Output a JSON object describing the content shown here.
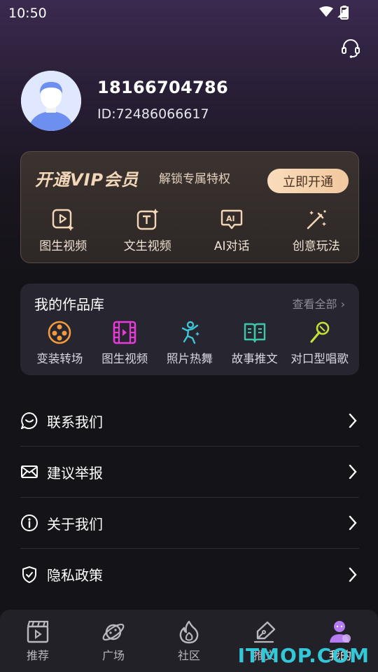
{
  "status": {
    "time": "10:50"
  },
  "profile": {
    "phone": "18166704786",
    "id_text": "ID:72486066617"
  },
  "vip": {
    "title": "开通VIP会员",
    "subtitle": "解锁专属特权",
    "open_label": "立即开通",
    "features": [
      {
        "label": "图生视频",
        "icon": "image-to-video-icon"
      },
      {
        "label": "文生视频",
        "icon": "text-to-video-icon"
      },
      {
        "label": "AI对话",
        "icon": "ai-chat-icon"
      },
      {
        "label": "创意玩法",
        "icon": "magic-wand-icon"
      }
    ]
  },
  "works": {
    "title": "我的作品库",
    "view_all": "查看全部 ›",
    "items": [
      {
        "label": "变装转场",
        "icon": "film-reel-icon"
      },
      {
        "label": "图生视频",
        "icon": "film-strip-icon"
      },
      {
        "label": "照片热舞",
        "icon": "dance-figure-icon"
      },
      {
        "label": "故事推文",
        "icon": "open-book-icon"
      },
      {
        "label": "对口型唱歌",
        "icon": "microphone-icon"
      }
    ]
  },
  "menu": [
    {
      "label": "联系我们",
      "icon": "chat-bubble-icon"
    },
    {
      "label": "建议举报",
      "icon": "mail-icon"
    },
    {
      "label": "关于我们",
      "icon": "info-icon"
    },
    {
      "label": "隐私政策",
      "icon": "shield-check-icon"
    }
  ],
  "tabs": [
    {
      "label": "推荐",
      "icon": "clapperboard-icon"
    },
    {
      "label": "广场",
      "icon": "planet-icon"
    },
    {
      "label": "社区",
      "icon": "flame-icon"
    },
    {
      "label": "推文",
      "icon": "pen-nib-icon"
    },
    {
      "label": "我的",
      "icon": "user-icon"
    }
  ],
  "watermark": "ITMOP.COM",
  "colors": {
    "accent_gold": "#f1c89f",
    "background": "#141318",
    "active_tab": "#b57bf2"
  }
}
